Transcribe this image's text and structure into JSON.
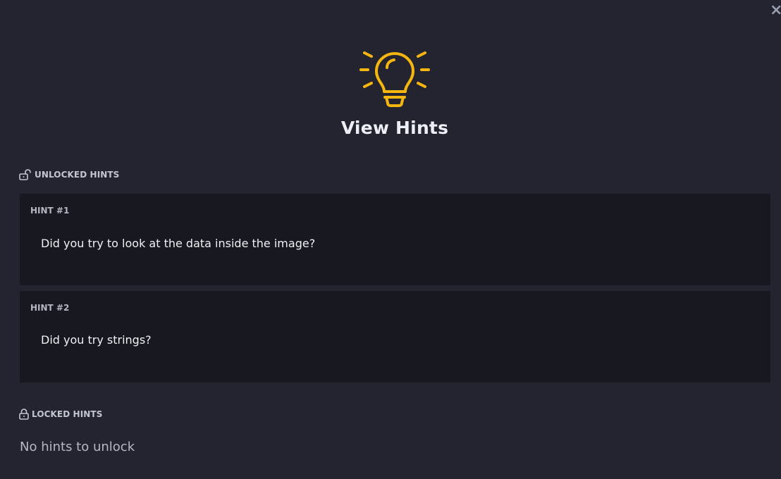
{
  "modal": {
    "title": "View Hints",
    "close_label": "×",
    "header_icon": "lightbulb-icon",
    "accent_color": "#f5b70f"
  },
  "unlocked": {
    "label": "UNLOCKED HINTS",
    "icon": "unlock-icon",
    "hints": [
      {
        "title": "HINT #1",
        "text": "Did you try to look at the data inside the image?"
      },
      {
        "title": "HINT #2",
        "text": "Did you try strings?"
      }
    ]
  },
  "locked": {
    "label": "LOCKED HINTS",
    "icon": "lock-icon",
    "empty_text": "No hints to unlock"
  }
}
